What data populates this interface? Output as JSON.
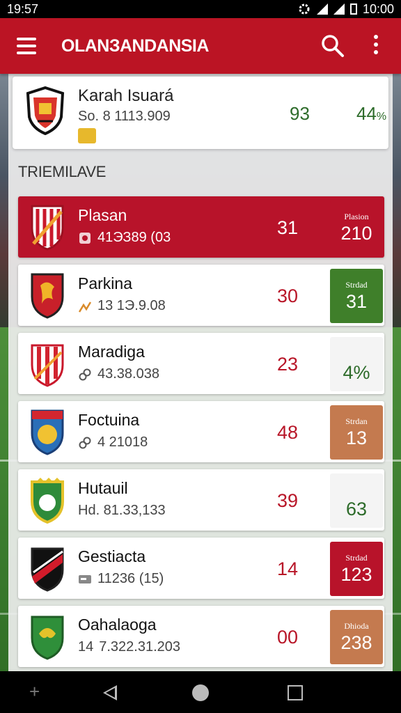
{
  "status_bar": {
    "time": "19:57",
    "clock": "10:00"
  },
  "app_bar": {
    "title": "OLANЗANDANSIA"
  },
  "featured": {
    "name": "Karah Isuará",
    "subtitle": "So. 8 1113.909",
    "value_a": "93",
    "value_b": "44",
    "value_b_unit": "%"
  },
  "section_title": "TRIEMILAVE",
  "colors": {
    "primary": "#bb1424",
    "green": "#3f7f2a",
    "orange": "#c47a4f",
    "red_box": "#b8132a"
  },
  "rows": [
    {
      "name": "Plasan",
      "sub": "41ЭЗ89 (03",
      "icon": "shield-icon",
      "points": "31",
      "box_label": "Plasion",
      "box_value": "210",
      "box_style": "highlight"
    },
    {
      "name": "Parkina",
      "sub": "13 1Э.9.08",
      "icon": "chart-icon",
      "points": "30",
      "box_label": "Strdad",
      "box_value": "31",
      "box_style": "green"
    },
    {
      "name": "Maradiga",
      "sub": "43.38.038",
      "icon": "link-icon",
      "points": "23",
      "box_label": "",
      "box_value": "4%",
      "box_style": "plain"
    },
    {
      "name": "Foctuina",
      "sub": "4 21018",
      "icon": "link-icon",
      "points": "48",
      "box_label": "Strdan",
      "box_value": "13",
      "box_style": "orange"
    },
    {
      "name": "Hutauil",
      "sub": "Hd. 81.33,133",
      "icon": "",
      "points": "39",
      "box_label": "",
      "box_value": "63",
      "box_style": "plain"
    },
    {
      "name": "Gestiacta",
      "sub": "11236 (15)",
      "icon": "card-icon",
      "points": "14",
      "box_label": "Strdad",
      "box_value": "123",
      "box_style": "red"
    },
    {
      "name": "Oahalaoga",
      "sub": "7.322.31.203",
      "sub_prefix": "14",
      "icon": "",
      "points": "00",
      "box_label": "Dhioda",
      "box_value": "238",
      "box_style": "orange"
    }
  ]
}
